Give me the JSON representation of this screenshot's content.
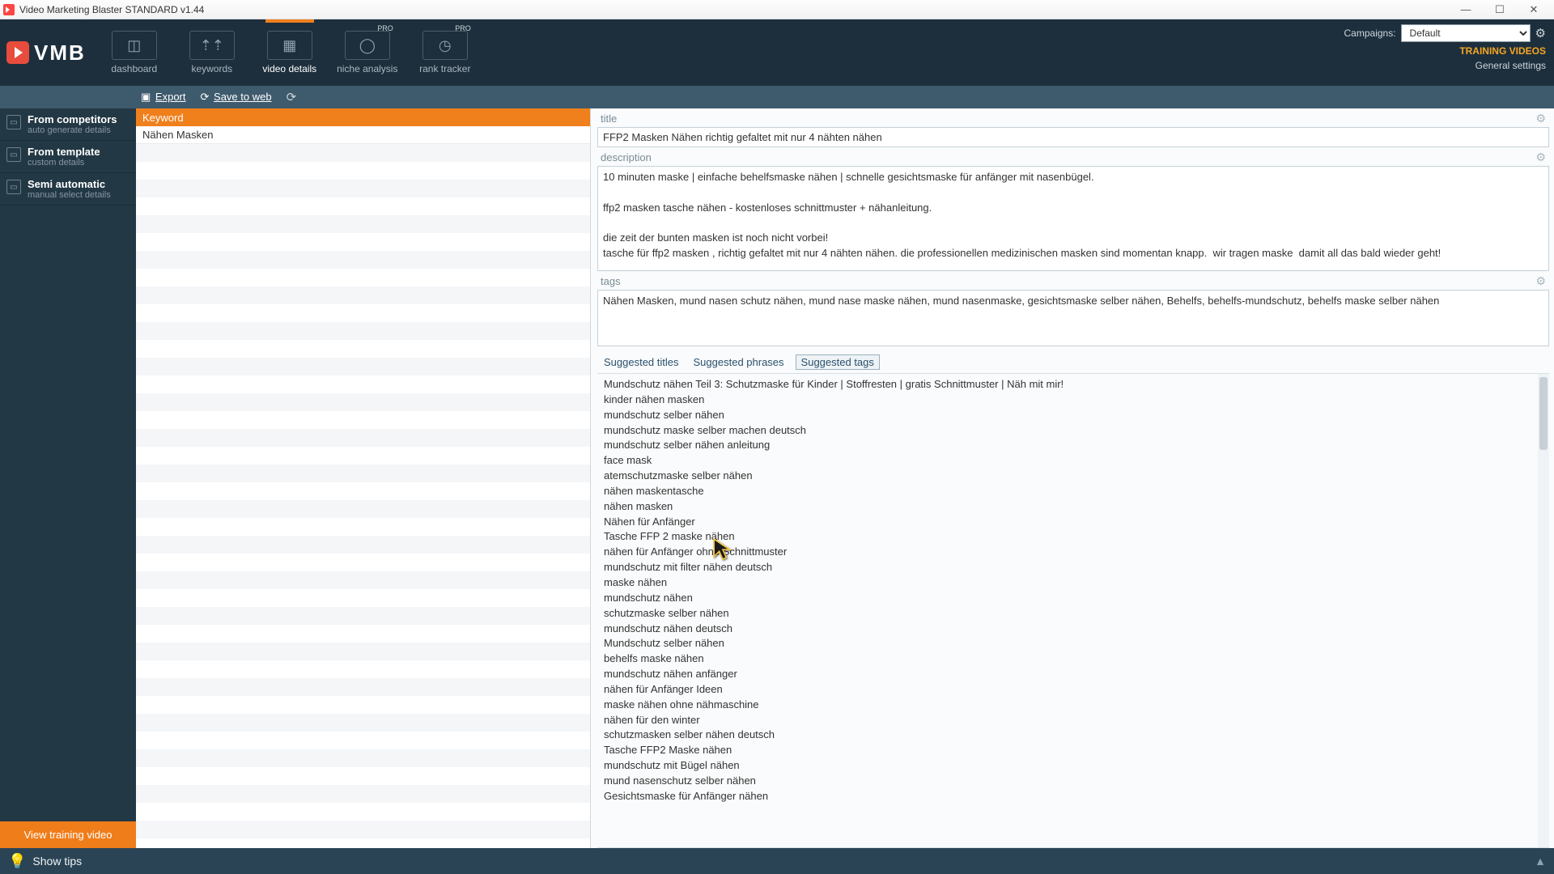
{
  "window": {
    "title": "Video Marketing Blaster STANDARD v1.44"
  },
  "logo": {
    "text": "VMB"
  },
  "nav": {
    "items": [
      {
        "label": "dashboard",
        "badge": ""
      },
      {
        "label": "keywords",
        "badge": ""
      },
      {
        "label": "video details",
        "badge": "",
        "active": true
      },
      {
        "label": "niche analysis",
        "badge": "PRO"
      },
      {
        "label": "rank tracker",
        "badge": "PRO"
      }
    ]
  },
  "topright": {
    "campaigns_label": "Campaigns:",
    "campaigns_value": "Default",
    "training": "TRAINING VIDEOS",
    "general_settings": "General settings"
  },
  "subtool": {
    "export": "Export",
    "save": "Save to web"
  },
  "leftrail": {
    "items": [
      {
        "title": "From competitors",
        "sub": "auto generate details"
      },
      {
        "title": "From template",
        "sub": "custom details"
      },
      {
        "title": "Semi automatic",
        "sub": "manual select details"
      }
    ],
    "training_btn": "View training video"
  },
  "keyword_col": {
    "header": "Keyword",
    "rows": [
      "Nähen Masken"
    ]
  },
  "details": {
    "title_label": "title",
    "title_value": "FFP2 Masken Nähen richtig gefaltet mit nur 4 nähten nähen",
    "desc_label": "description",
    "desc_value": "10 minuten maske | einfache behelfsmaske nähen | schnelle gesichtsmaske für anfänger mit nasenbügel.\n\nffp2 masken tasche nähen - kostenloses schnittmuster + nähanleitung.\n\ndie zeit der bunten masken ist noch nicht vorbei!\ntasche für ffp2 masken , richtig gefaltet mit nur 4 nähten nähen. die professionellen medizinischen masken sind momentan knapp.  wir tragen maske  damit all das bald wieder geht!",
    "tags_label": "tags",
    "tags_value": "Nähen Masken, mund nasen schutz nähen, mund nase maske nähen, mund nasenmaske, gesichtsmaske selber nähen, Behelfs, behelfs-mundschutz, behelfs maske selber nähen",
    "tabs": {
      "titles": "Suggested titles",
      "phrases": "Suggested phrases",
      "tags": "Suggested tags"
    },
    "suggestions": [
      "Mundschutz nähen Teil 3: Schutzmaske für Kinder | Stoffresten | gratis Schnittmuster | Näh mit mir!",
      "kinder nähen masken",
      "mundschutz selber nähen",
      "mundschutz maske selber machen deutsch",
      "mundschutz selber nähen anleitung",
      "face mask",
      "atemschutzmaske selber nähen",
      "nähen maskentasche",
      "nähen masken",
      "Nähen für Anfänger",
      "Tasche FFP 2 maske nähen",
      "nähen für Anfänger ohne Schnittmuster",
      "mundschutz mit filter nähen deutsch",
      "maske nähen",
      "mundschutz nähen",
      "schutzmaske selber nähen",
      "mundschutz nähen deutsch",
      "Mundschutz selber nähen",
      "behelfs maske nähen",
      "mundschutz nähen anfänger",
      "nähen für Anfänger Ideen",
      "maske nähen ohne nähmaschine",
      "nähen für den winter",
      "schutzmasken selber nähen deutsch",
      "Tasche FFP2 Maske nähen",
      "mundschutz mit Bügel nähen",
      "mund nasenschutz selber nähen",
      "Gesichtsmaske für Anfänger nähen"
    ]
  },
  "bottombar": {
    "showtips": "Show tips"
  }
}
